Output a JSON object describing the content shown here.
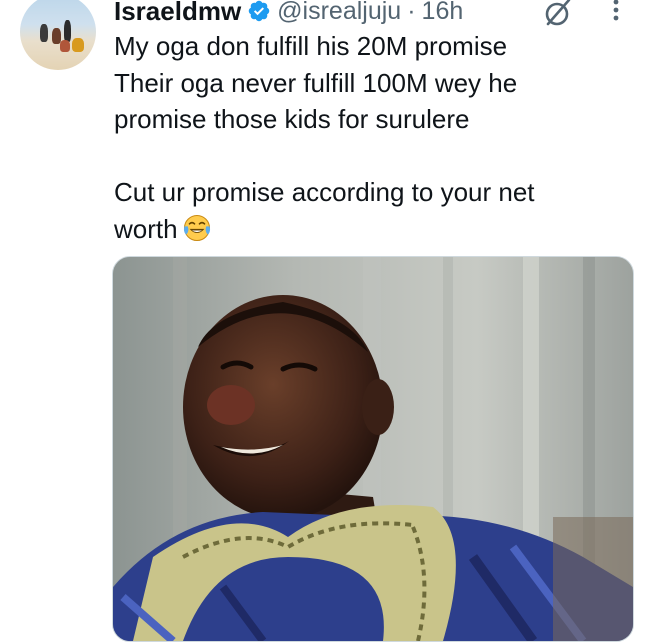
{
  "tweet": {
    "author_name": "Israeldmw",
    "handle": "@isrealjuju",
    "separator": "·",
    "time": "16h",
    "lines_paragraph_1": [
      "My oga don fulfill his 20M promise",
      "Their oga never fulfill 100M wey he",
      "promise those kids for surulere"
    ],
    "lines_paragraph_2": [
      "Cut ur promise according to your net",
      "worth"
    ],
    "emoji": "face-with-tears-of-joy",
    "media": "photo of a smiling man in a blue patterned agbada"
  },
  "colors": {
    "text": "#0f1419",
    "secondary": "#536471",
    "verified": "#1d9bf0",
    "border": "#cfd9de"
  },
  "icons": [
    "verified-badge-icon",
    "grok-icon",
    "more-options-icon"
  ]
}
